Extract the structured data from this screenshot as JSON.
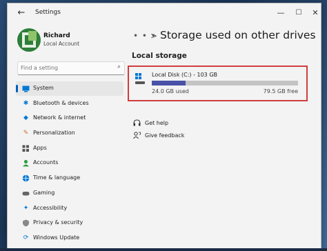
{
  "window": {
    "title": "Settings"
  },
  "controls": {
    "back": "←",
    "minimize": "—",
    "maximize": "☐",
    "close": "✕"
  },
  "profile": {
    "name": "Richard",
    "type": "Local Account"
  },
  "search": {
    "placeholder": "Find a setting",
    "icon": "search-icon"
  },
  "sidebar": {
    "items": [
      {
        "label": "System",
        "icon": "system-icon",
        "color": "#0078d4",
        "active": true
      },
      {
        "label": "Bluetooth & devices",
        "icon": "bluetooth-icon",
        "color": "#0078d4"
      },
      {
        "label": "Network & internet",
        "icon": "network-icon",
        "color": "#0078d4"
      },
      {
        "label": "Personalization",
        "icon": "brush-icon",
        "color": "#d36c2a"
      },
      {
        "label": "Apps",
        "icon": "apps-icon",
        "color": "#555555"
      },
      {
        "label": "Accounts",
        "icon": "accounts-icon",
        "color": "#2ea043"
      },
      {
        "label": "Time & language",
        "icon": "globe-icon",
        "color": "#0078d4"
      },
      {
        "label": "Gaming",
        "icon": "gaming-icon",
        "color": "#666666"
      },
      {
        "label": "Accessibility",
        "icon": "accessibility-icon",
        "color": "#0078d4"
      },
      {
        "label": "Privacy & security",
        "icon": "shield-icon",
        "color": "#777777"
      },
      {
        "label": "Windows Update",
        "icon": "update-icon",
        "color": "#0078d4"
      }
    ]
  },
  "main": {
    "breadcrumb_more": "• • •",
    "breadcrumb_separator": ">",
    "title": "Storage used on other drives",
    "section": "Local storage",
    "drive": {
      "name": "Local Disk (C:) - 103 GB",
      "used": "24.0 GB used",
      "free": "79.5 GB free",
      "used_fraction": 0.233,
      "bar_color": "#4a52a7",
      "highlight_color": "#d23c3c"
    },
    "links": [
      {
        "label": "Get help",
        "icon": "help-icon"
      },
      {
        "label": "Give feedback",
        "icon": "feedback-icon"
      }
    ]
  }
}
